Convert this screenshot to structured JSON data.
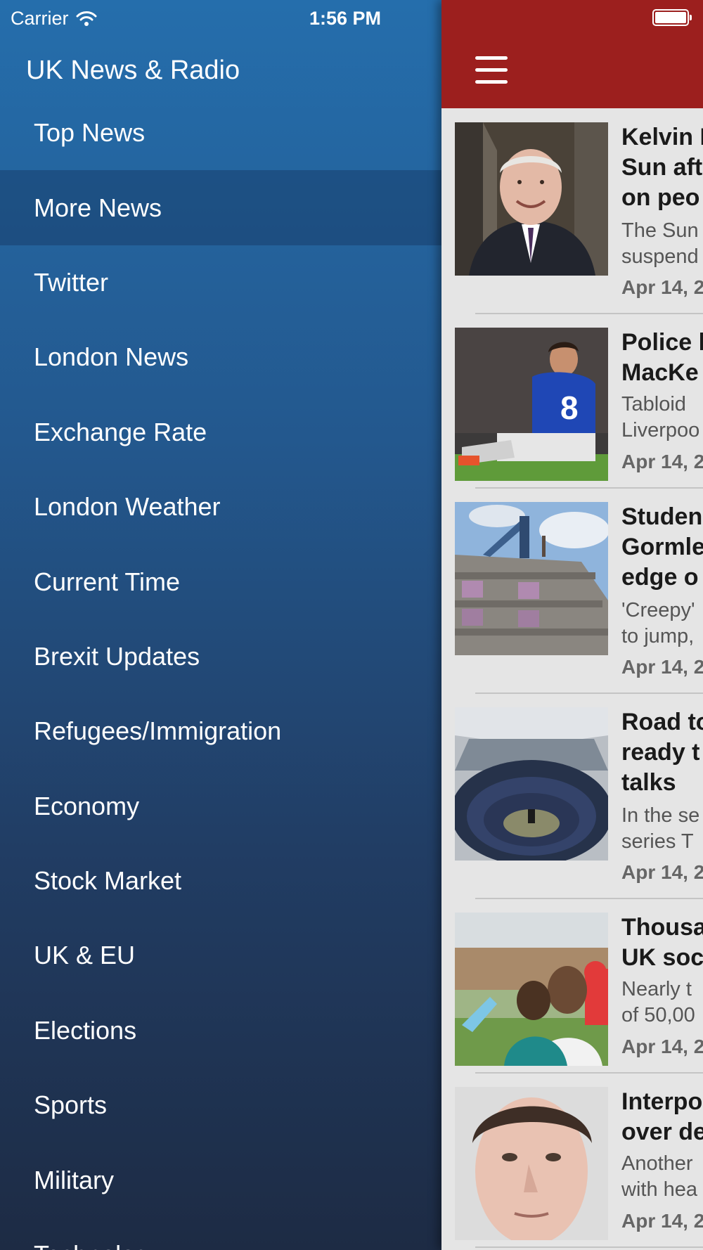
{
  "status_bar": {
    "carrier": "Carrier",
    "time": "1:56 PM",
    "wifi_icon": "wifi-icon",
    "battery_icon": "battery-icon"
  },
  "sidebar": {
    "title": "UK News & Radio",
    "selected_index": 1,
    "items": [
      {
        "label": "Top News"
      },
      {
        "label": "More News"
      },
      {
        "label": "Twitter"
      },
      {
        "label": "London News"
      },
      {
        "label": "Exchange Rate"
      },
      {
        "label": "London Weather"
      },
      {
        "label": "Current Time"
      },
      {
        "label": "Brexit Updates"
      },
      {
        "label": "Refugees/Immigration"
      },
      {
        "label": "Economy"
      },
      {
        "label": "Stock Market"
      },
      {
        "label": "UK & EU"
      },
      {
        "label": "Elections"
      },
      {
        "label": "Sports"
      },
      {
        "label": "Military"
      },
      {
        "label": "Technology"
      }
    ]
  },
  "navbar": {
    "menu_icon": "hamburger-icon",
    "color": "#9c1f1e"
  },
  "articles": [
    {
      "headline_lines": [
        "Kelvin M",
        "Sun aft",
        "on peo"
      ],
      "summary_lines": [
        "The Sun",
        "suspend"
      ],
      "date": "Apr 14, 2",
      "image": "photo of a smiling grey-haired man in a suit"
    },
    {
      "headline_lines": [
        "Police l",
        "MacKe"
      ],
      "summary_lines": [
        "Tabloid",
        "Liverpoo"
      ],
      "date": "Apr 14, 2",
      "image": "photo of a footballer in a blue number 8 shirt sitting on the pitch"
    },
    {
      "headline_lines": [
        "Studen",
        "Gormle",
        "edge o"
      ],
      "summary_lines": [
        "'Creepy'",
        "to jump,"
      ],
      "date": "Apr 14, 2",
      "image": "photo of a building roof with a crane and a statue"
    },
    {
      "headline_lines": [
        "Road to",
        "ready t",
        "talks"
      ],
      "summary_lines": [
        "In the se",
        "series T"
      ],
      "date": "Apr 14, 2",
      "image": "photo of a parliament plenary chamber"
    },
    {
      "headline_lines": [
        "Thousa",
        "UK soc"
      ],
      "summary_lines": [
        "Nearly t",
        "of 50,00"
      ],
      "date": "Apr 14, 2",
      "image": "photo of a woman hugging a child in a garden"
    },
    {
      "headline_lines": [
        "Interpo",
        "over de"
      ],
      "summary_lines": [
        "Another",
        "with hea"
      ],
      "date": "Apr 14, 2",
      "image": "portrait photo of a young man"
    }
  ]
}
